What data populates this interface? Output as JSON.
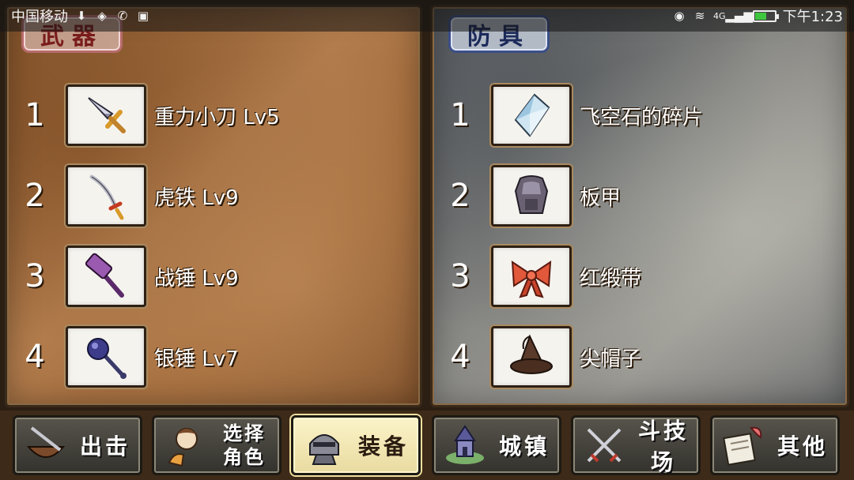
{
  "status_bar": {
    "carrier": "中国移动",
    "network": "4G",
    "time": "下午1:23",
    "battery_level": 0.55
  },
  "weapons_panel": {
    "title": "武器",
    "items": [
      {
        "number": "1",
        "name": "重力小刀 Lv5",
        "icon": "dagger-icon"
      },
      {
        "number": "2",
        "name": "虎铁 Lv9",
        "icon": "sword-icon"
      },
      {
        "number": "3",
        "name": "战锤 Lv9",
        "icon": "warhammer-icon"
      },
      {
        "number": "4",
        "name": "银锤 Lv7",
        "icon": "mace-icon"
      }
    ]
  },
  "armor_panel": {
    "title": "防具",
    "items": [
      {
        "number": "1",
        "name": "飞空石的碎片",
        "icon": "crystal-shard-icon"
      },
      {
        "number": "2",
        "name": "板甲",
        "icon": "plate-armor-icon"
      },
      {
        "number": "3",
        "name": "红缎带",
        "icon": "red-ribbon-icon"
      },
      {
        "number": "4",
        "name": "尖帽子",
        "icon": "pointed-hat-icon"
      }
    ]
  },
  "bottom_nav": [
    {
      "label": "出击",
      "icon": "sortie-icon",
      "active": false
    },
    {
      "label_line1": "选择",
      "label_line2": "角色",
      "icon": "character-icon",
      "active": false
    },
    {
      "label": "装备",
      "icon": "equipment-icon",
      "active": true
    },
    {
      "label": "城镇",
      "icon": "town-icon",
      "active": false
    },
    {
      "label": "斗技场",
      "icon": "arena-icon",
      "active": false
    },
    {
      "label": "其他",
      "icon": "other-icon",
      "active": false
    }
  ],
  "colors": {
    "weapons_title": "#7a1c1c",
    "armor_title": "#1c2a5a",
    "active_nav": "#fbf3c9"
  }
}
